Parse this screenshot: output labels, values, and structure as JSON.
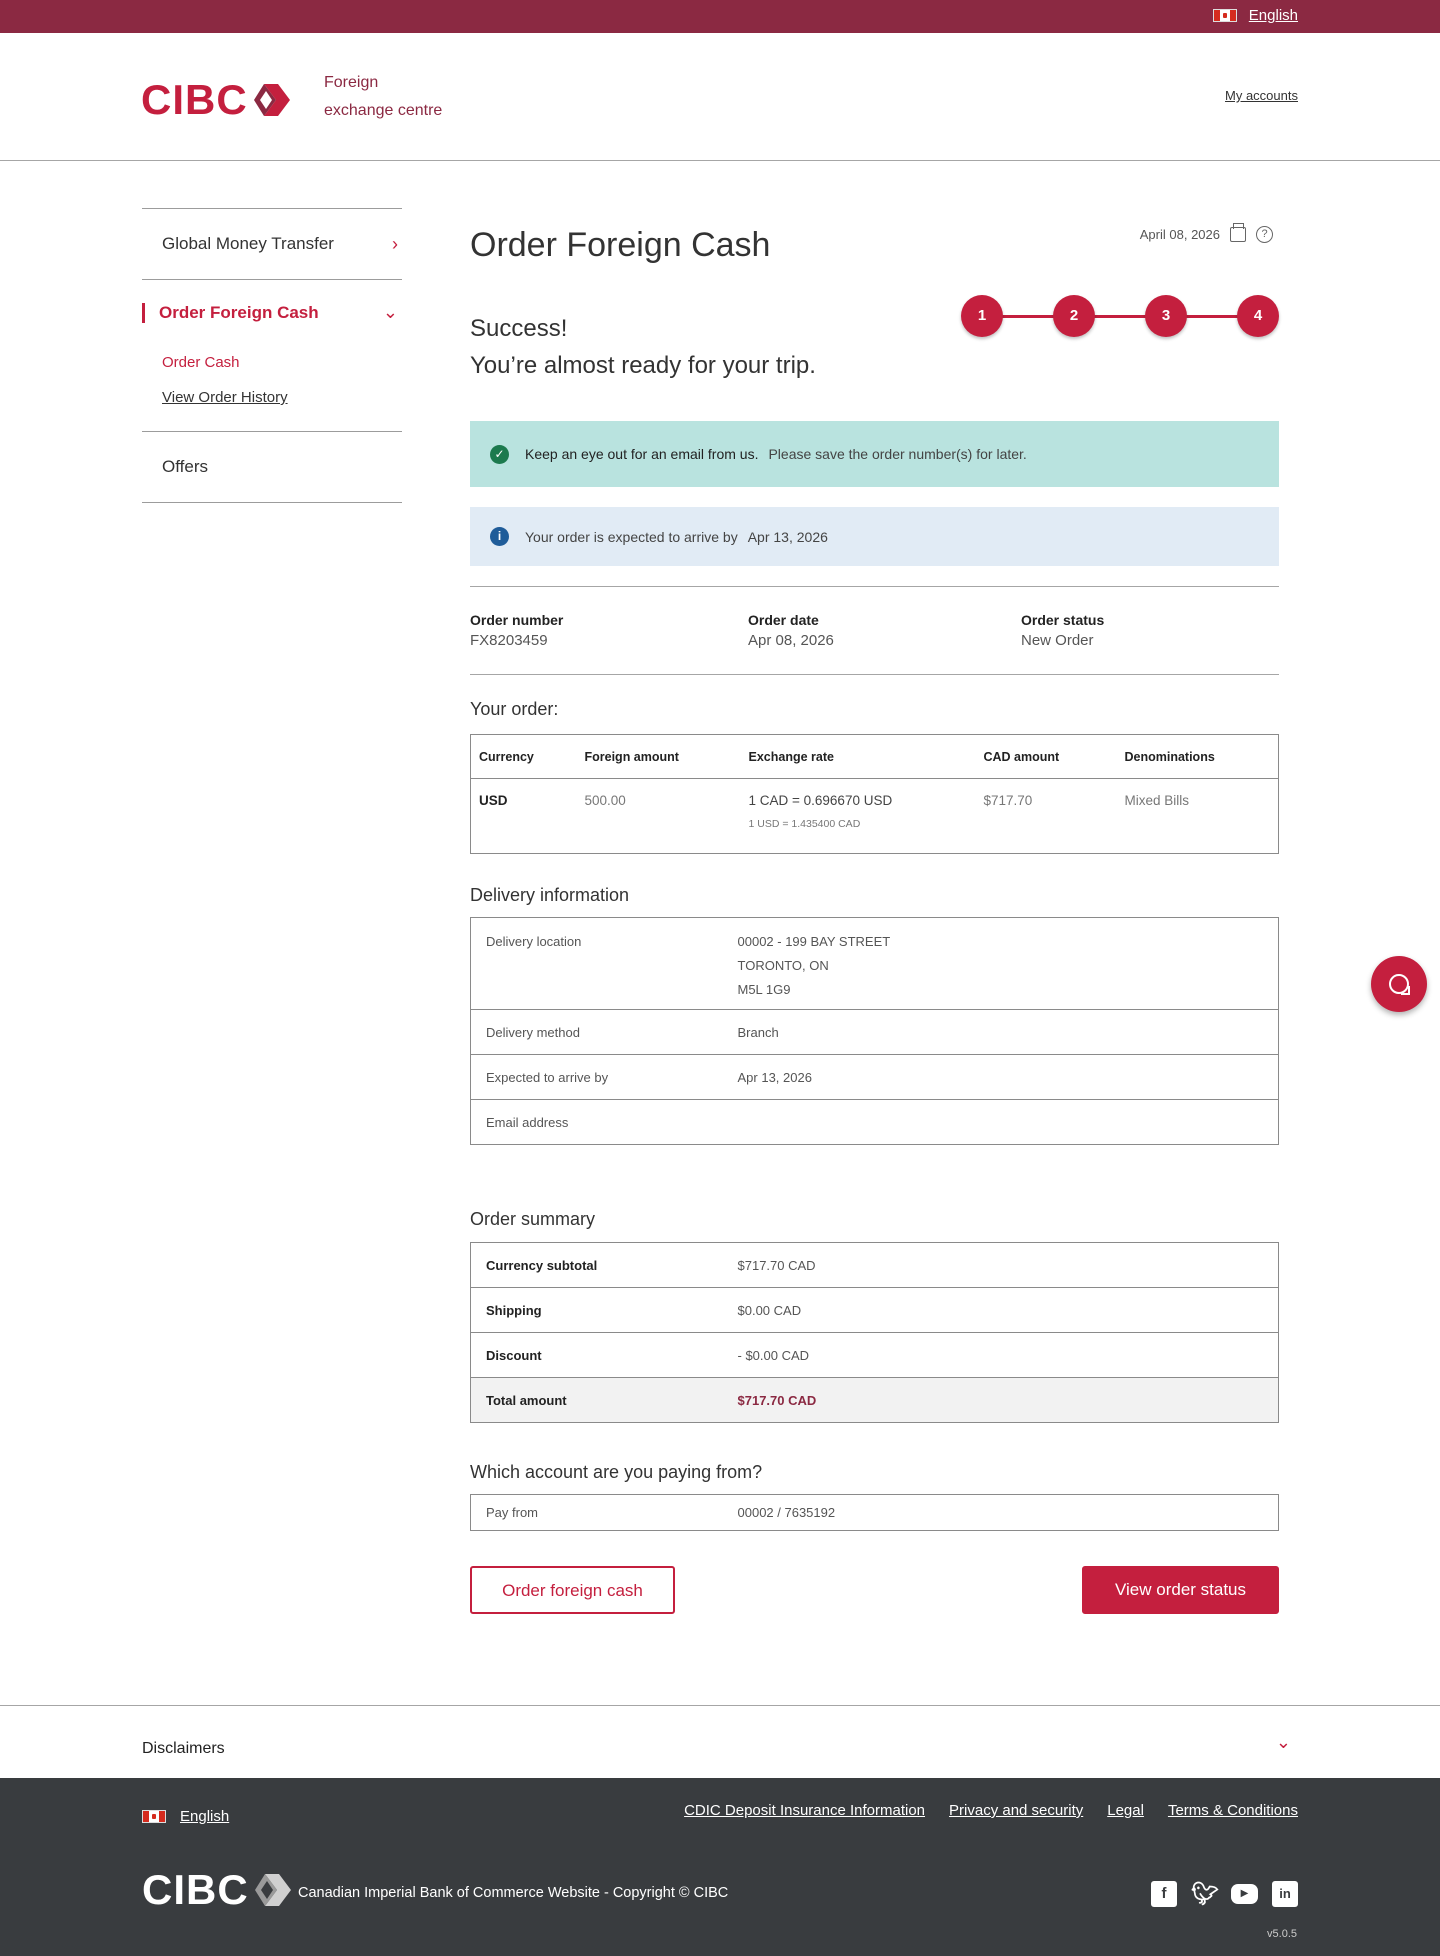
{
  "topbar": {
    "language": "English"
  },
  "header": {
    "logo_text": "CIBC",
    "title_line1": "Foreign",
    "title_line2": "exchange centre",
    "my_accounts": "My accounts"
  },
  "sidebar": {
    "items": [
      {
        "label": "Global Money Transfer"
      },
      {
        "label": "Order Foreign Cash",
        "sub": [
          "Order Cash",
          "View Order History"
        ]
      },
      {
        "label": "Offers"
      }
    ]
  },
  "main": {
    "title": "Order Foreign Cash",
    "date": "April 08, 2026",
    "success_line1": "Success!",
    "success_line2": "You’re almost ready for your trip.",
    "steps": [
      "1",
      "2",
      "3",
      "4"
    ],
    "alert_ok_strong": "Keep an eye out for an email from us.",
    "alert_ok_note": "Please save the order number(s) for later.",
    "alert_info_text": "Your order is expected to arrive by",
    "alert_info_date": "Apr 13, 2026",
    "order_number_label": "Order number",
    "order_number": "FX8203459",
    "order_date_label": "Order date",
    "order_date": "Apr 08, 2026",
    "order_status_label": "Order status",
    "order_status": "New Order",
    "your_order_title": "Your order:",
    "order_table": {
      "headers": [
        "Currency",
        "Foreign amount",
        "Exchange rate",
        "CAD amount",
        "Denominations"
      ],
      "row": {
        "currency": "USD",
        "foreign_amount": "500.00",
        "rate": "1 CAD = 0.696670 USD",
        "rate_sub": "1 USD = 1.435400 CAD",
        "cad_amount": "$717.70",
        "denominations": "Mixed Bills"
      }
    },
    "delivery_title": "Delivery information",
    "delivery": {
      "location_label": "Delivery location",
      "location_line1": "00002 - 199 BAY STREET",
      "location_line2": "TORONTO, ON",
      "location_line3": "M5L 1G9",
      "method_label": "Delivery method",
      "method": "Branch",
      "arrive_label": "Expected to arrive by",
      "arrive": "Apr 13, 2026",
      "email_label": "Email address",
      "email": ""
    },
    "summary_title": "Order summary",
    "summary": {
      "subtotal_label": "Currency subtotal",
      "subtotal": "$717.70 CAD",
      "shipping_label": "Shipping",
      "shipping": "$0.00 CAD",
      "discount_label": "Discount",
      "discount": "- $0.00 CAD",
      "total_label": "Total amount",
      "total": "$717.70 CAD"
    },
    "account_title": "Which account are you paying from?",
    "pay_from_label": "Pay from",
    "pay_from": "00002 / 7635192",
    "btn_order": "Order foreign cash",
    "btn_status": "View order status"
  },
  "disclaimers": {
    "label": "Disclaimers"
  },
  "footer": {
    "language": "English",
    "links": [
      "CDIC Deposit Insurance Information",
      "Privacy and security",
      "Legal",
      "Terms & Conditions"
    ],
    "logo_text": "CIBC",
    "copyright": "Canadian Imperial Bank of Commerce Website - Copyright © CIBC",
    "version": "v5.0.5"
  },
  "colors": {
    "brand_red": "#c41f3e",
    "burgundy": "#8b2942",
    "footer_bg": "#393c3f",
    "success_bg": "#b9e3df",
    "info_bg": "#e1ebf5"
  }
}
